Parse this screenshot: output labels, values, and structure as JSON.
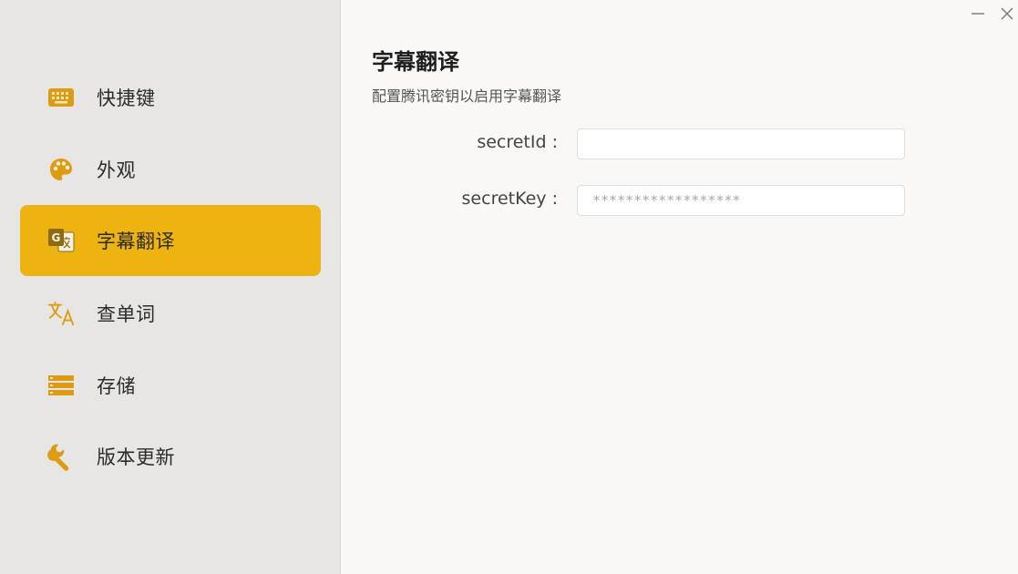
{
  "window": {
    "minimize_glyph": "—",
    "close_glyph": "✕"
  },
  "colors": {
    "accent": "#ecb311",
    "icon": "#dd9b12",
    "sidebar_bg": "#e7e6e4",
    "main_bg": "#f9f8f6"
  },
  "sidebar": {
    "items": [
      {
        "label": "快捷键",
        "icon": "keyboard-icon",
        "active": false
      },
      {
        "label": "外观",
        "icon": "palette-icon",
        "active": false
      },
      {
        "label": "字幕翻译",
        "icon": "google-translate-icon",
        "active": true
      },
      {
        "label": "查单词",
        "icon": "translate-icon",
        "active": false
      },
      {
        "label": "存储",
        "icon": "storage-icon",
        "active": false
      },
      {
        "label": "版本更新",
        "icon": "wrench-icon",
        "active": false
      }
    ]
  },
  "main": {
    "title": "字幕翻译",
    "subtitle": "配置腾讯密钥以启用字幕翻译",
    "fields": {
      "secret_id": {
        "label": "secretId :",
        "value": "",
        "placeholder": ""
      },
      "secret_key": {
        "label": "secretKey :",
        "value": "",
        "placeholder": "******************"
      }
    }
  }
}
